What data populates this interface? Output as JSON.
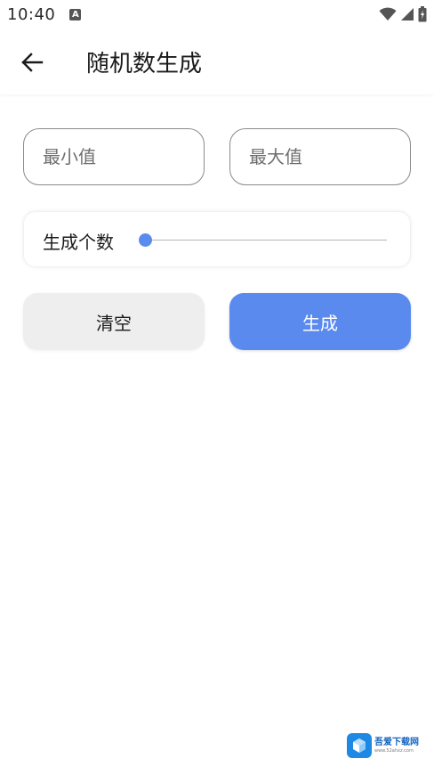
{
  "status_bar": {
    "time": "10:40",
    "notification_icon": "a-icon",
    "icons": [
      "wifi-icon",
      "signal-icon",
      "battery-icon"
    ]
  },
  "header": {
    "back_icon": "arrow-left-icon",
    "title": "随机数生成"
  },
  "form": {
    "min_input": {
      "placeholder": "最小值",
      "value": ""
    },
    "max_input": {
      "placeholder": "最大值",
      "value": ""
    },
    "count_slider": {
      "label": "生成个数",
      "value_fraction": 0.0
    }
  },
  "actions": {
    "clear_label": "清空",
    "generate_label": "生成"
  },
  "watermark": {
    "title": "吾爱下载网",
    "subtitle": "www.52ahxz.com"
  },
  "colors": {
    "accent": "#5b8aef",
    "slider_thumb": "#5a8cef",
    "clear_button_bg": "#eeeeee",
    "input_border": "#8a8a8a"
  }
}
